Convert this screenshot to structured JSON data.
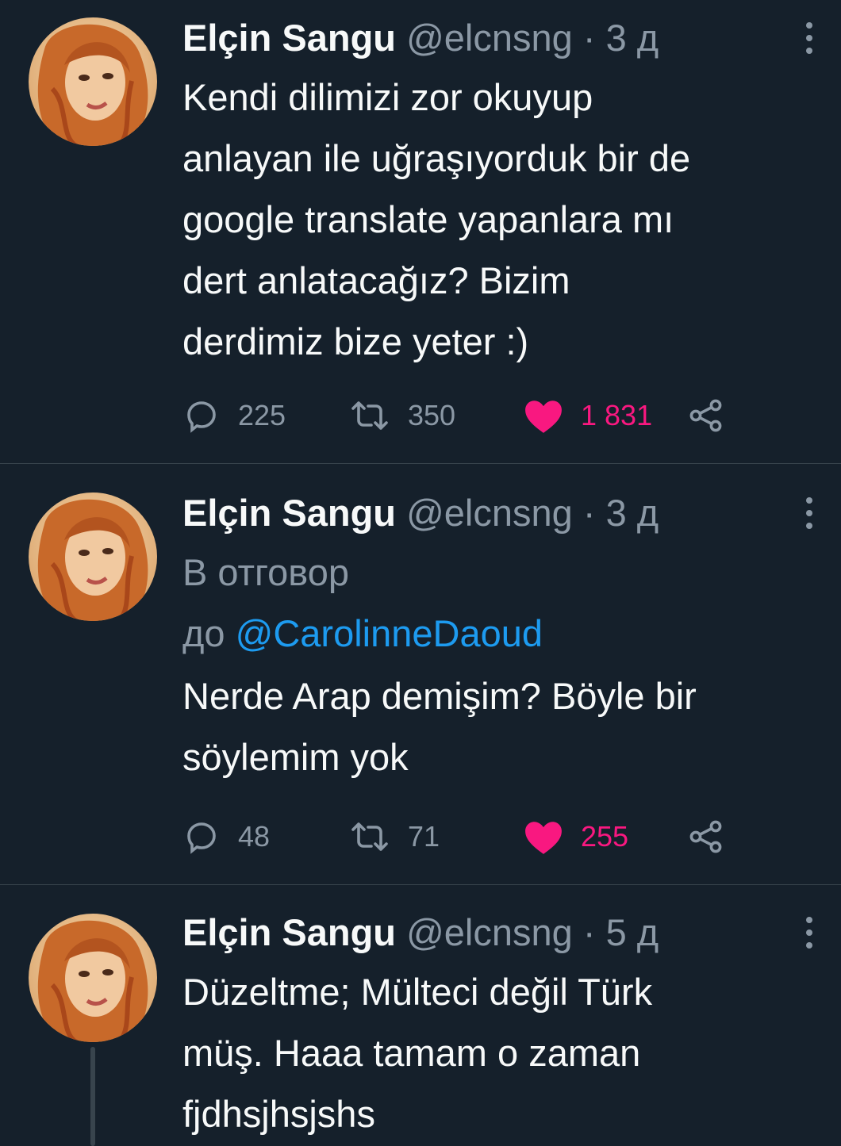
{
  "colors": {
    "background": "#15202b",
    "text": "#f7f9f9",
    "muted": "#8b98a5",
    "divider": "#38444d",
    "link": "#1d9bf0",
    "like": "#f91880"
  },
  "icons": [
    "more-vertical-icon",
    "reply-icon",
    "retweet-icon",
    "heart-icon",
    "share-icon"
  ],
  "tweets": [
    {
      "name": "Elçin Sangu",
      "handle": "@elcnsng",
      "separator": "·",
      "time": "3 д",
      "text": "Kendi dilimizi zor okuyup\nanlayan ile uğraşıyorduk bir de\ngoogle translate yapanlara mı\ndert anlatacağız? Bizim\nderdimiz bize yeter :)",
      "replies": "225",
      "retweets": "350",
      "likes": "1 831",
      "liked": true
    },
    {
      "name": "Elçin Sangu",
      "handle": "@elcnsng",
      "separator": "·",
      "time": "3 д",
      "reply_label": "В отговор",
      "reply_to_prefix": "до",
      "reply_to": "@CarolinneDaoud",
      "text": "Nerde Arap demişim? Böyle bir\nsöylemim yok",
      "replies": "48",
      "retweets": "71",
      "likes": "255",
      "liked": true
    },
    {
      "name": "Elçin Sangu",
      "handle": "@elcnsng",
      "separator": "·",
      "time": "5 д",
      "text": "Düzeltme; Mülteci değil Türk\nmüş.  Haaa tamam o zaman\nfjdhsjhsjshs"
    }
  ]
}
